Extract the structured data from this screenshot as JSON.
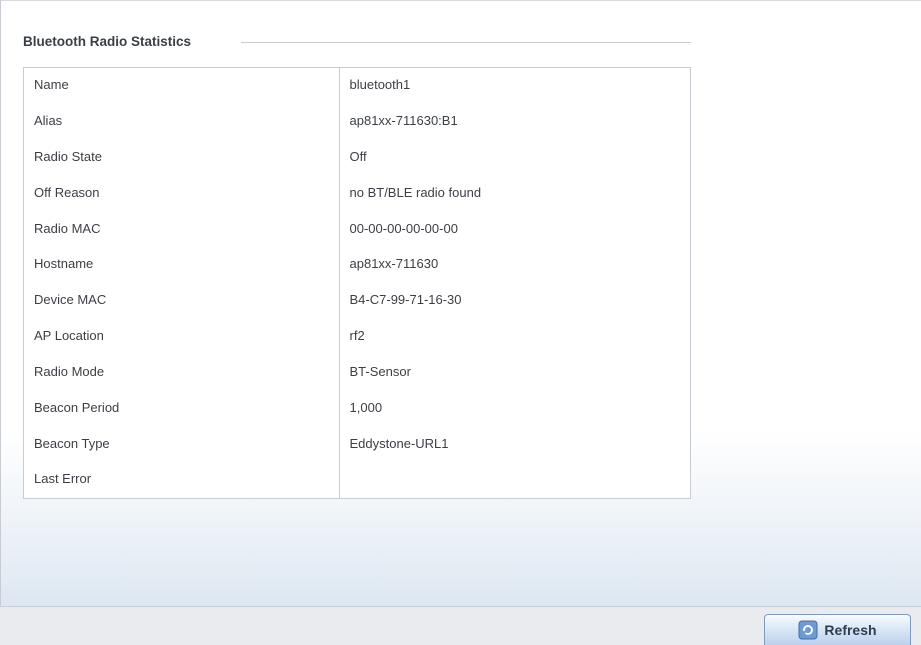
{
  "section": {
    "title": "Bluetooth Radio Statistics"
  },
  "stats": [
    {
      "label": "Name",
      "value": "bluetooth1"
    },
    {
      "label": "Alias",
      "value": "ap81xx-711630:B1"
    },
    {
      "label": "Radio State",
      "value": "Off"
    },
    {
      "label": "Off Reason",
      "value": "no BT/BLE radio found"
    },
    {
      "label": "Radio MAC",
      "value": "00-00-00-00-00-00"
    },
    {
      "label": "Hostname",
      "value": "ap81xx-711630"
    },
    {
      "label": "Device MAC",
      "value": "B4-C7-99-71-16-30"
    },
    {
      "label": "AP Location",
      "value": "rf2"
    },
    {
      "label": "Radio Mode",
      "value": "BT-Sensor"
    },
    {
      "label": "Beacon Period",
      "value": "1,000"
    },
    {
      "label": "Beacon Type",
      "value": "Eddystone-URL1"
    },
    {
      "label": "Last Error",
      "value": ""
    }
  ],
  "footer": {
    "refresh_label": "Refresh",
    "refresh_icon": "refresh-icon"
  }
}
